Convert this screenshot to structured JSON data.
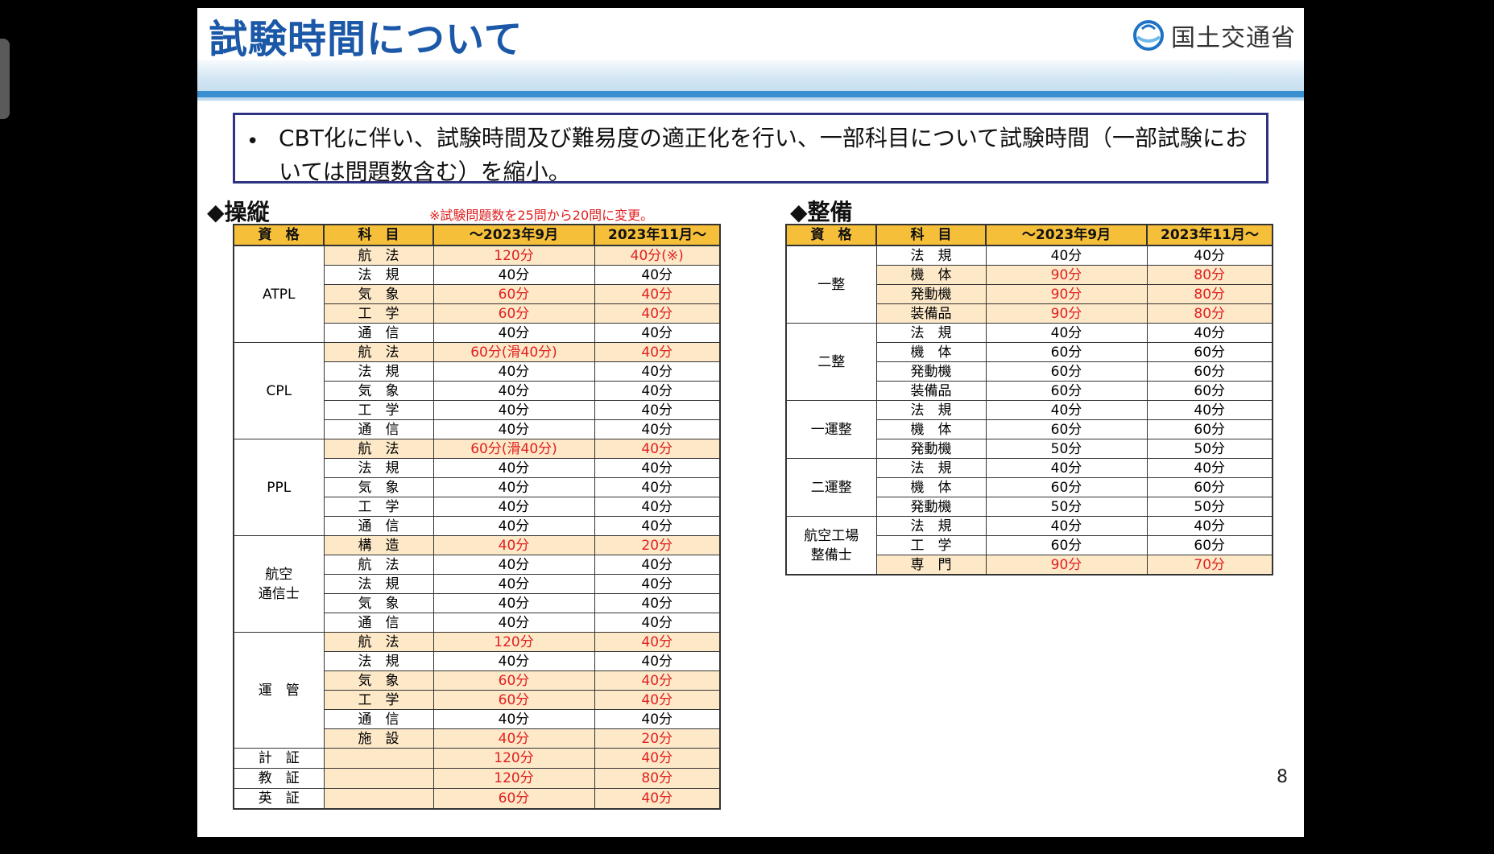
{
  "slide": {
    "title": "試験時間について",
    "logo_text": "国土交通省",
    "note": "CBT化に伴い、試験時間及び難易度の適正化を行い、一部科目について試験時間（一部試験においては問題数含む）を縮小。",
    "page_number": "8"
  },
  "pilot": {
    "section_title": "◆操縦",
    "section_note": "※試験問題数を25問から20問に変更。",
    "headers": [
      "資　格",
      "科　目",
      "～2023年9月",
      "2023年11月～"
    ],
    "rows": [
      {
        "qual": "ATPL",
        "span": 5,
        "subject": "航　法",
        "before": "120分",
        "after": "40分(※)",
        "hl": true,
        "red": true
      },
      {
        "subject": "法　規",
        "before": "40分",
        "after": "40分",
        "hl": false,
        "red": false
      },
      {
        "subject": "気　象",
        "before": "60分",
        "after": "40分",
        "hl": true,
        "red": true
      },
      {
        "subject": "工　学",
        "before": "60分",
        "after": "40分",
        "hl": true,
        "red": true
      },
      {
        "subject": "通　信",
        "before": "40分",
        "after": "40分",
        "hl": false,
        "red": false
      },
      {
        "qual": "CPL",
        "span": 5,
        "subject": "航　法",
        "before": "60分(滑40分)",
        "after": "40分",
        "hl": true,
        "red": true
      },
      {
        "subject": "法　規",
        "before": "40分",
        "after": "40分",
        "hl": false,
        "red": false
      },
      {
        "subject": "気　象",
        "before": "40分",
        "after": "40分",
        "hl": false,
        "red": false
      },
      {
        "subject": "工　学",
        "before": "40分",
        "after": "40分",
        "hl": false,
        "red": false
      },
      {
        "subject": "通　信",
        "before": "40分",
        "after": "40分",
        "hl": false,
        "red": false
      },
      {
        "qual": "PPL",
        "span": 5,
        "subject": "航　法",
        "before": "60分(滑40分)",
        "after": "40分",
        "hl": true,
        "red": true
      },
      {
        "subject": "法　規",
        "before": "40分",
        "after": "40分",
        "hl": false,
        "red": false
      },
      {
        "subject": "気　象",
        "before": "40分",
        "after": "40分",
        "hl": false,
        "red": false
      },
      {
        "subject": "工　学",
        "before": "40分",
        "after": "40分",
        "hl": false,
        "red": false
      },
      {
        "subject": "通　信",
        "before": "40分",
        "after": "40分",
        "hl": false,
        "red": false
      },
      {
        "qual": "航空\n通信士",
        "span": 5,
        "subject": "構　造",
        "before": "40分",
        "after": "20分",
        "hl": true,
        "red": true
      },
      {
        "subject": "航　法",
        "before": "40分",
        "after": "40分",
        "hl": false,
        "red": false
      },
      {
        "subject": "法　規",
        "before": "40分",
        "after": "40分",
        "hl": false,
        "red": false
      },
      {
        "subject": "気　象",
        "before": "40分",
        "after": "40分",
        "hl": false,
        "red": false
      },
      {
        "subject": "通　信",
        "before": "40分",
        "after": "40分",
        "hl": false,
        "red": false
      },
      {
        "qual": "運　管",
        "span": 6,
        "subject": "航　法",
        "before": "120分",
        "after": "40分",
        "hl": true,
        "red": true
      },
      {
        "subject": "法　規",
        "before": "40分",
        "after": "40分",
        "hl": false,
        "red": false
      },
      {
        "subject": "気　象",
        "before": "60分",
        "after": "40分",
        "hl": true,
        "red": true
      },
      {
        "subject": "工　学",
        "before": "60分",
        "after": "40分",
        "hl": true,
        "red": true
      },
      {
        "subject": "通　信",
        "before": "40分",
        "after": "40分",
        "hl": false,
        "red": false
      },
      {
        "subject": "施　設",
        "before": "40分",
        "after": "20分",
        "hl": true,
        "red": true
      },
      {
        "qual": "計　証",
        "span": 1,
        "subject": "",
        "before": "120分",
        "after": "40分",
        "hl": true,
        "red": true
      },
      {
        "qual": "教　証",
        "span": 1,
        "subject": "",
        "before": "120分",
        "after": "80分",
        "hl": true,
        "red": true
      },
      {
        "qual": "英　証",
        "span": 1,
        "subject": "",
        "before": "60分",
        "after": "40分",
        "hl": true,
        "red": true
      }
    ]
  },
  "maintenance": {
    "section_title": "◆整備",
    "headers": [
      "資　格",
      "科　目",
      "～2023年9月",
      "2023年11月～"
    ],
    "rows": [
      {
        "qual": "一整",
        "span": 4,
        "subject": "法　規",
        "before": "40分",
        "after": "40分",
        "hl": false,
        "red": false
      },
      {
        "subject": "機　体",
        "before": "90分",
        "after": "80分",
        "hl": true,
        "red": true
      },
      {
        "subject": "発動機",
        "before": "90分",
        "after": "80分",
        "hl": true,
        "red": true
      },
      {
        "subject": "装備品",
        "before": "90分",
        "after": "80分",
        "hl": true,
        "red": true
      },
      {
        "qual": "二整",
        "span": 4,
        "subject": "法　規",
        "before": "40分",
        "after": "40分",
        "hl": false,
        "red": false
      },
      {
        "subject": "機　体",
        "before": "60分",
        "after": "60分",
        "hl": false,
        "red": false
      },
      {
        "subject": "発動機",
        "before": "60分",
        "after": "60分",
        "hl": false,
        "red": false
      },
      {
        "subject": "装備品",
        "before": "60分",
        "after": "60分",
        "hl": false,
        "red": false
      },
      {
        "qual": "一運整",
        "span": 3,
        "subject": "法　規",
        "before": "40分",
        "after": "40分",
        "hl": false,
        "red": false
      },
      {
        "subject": "機　体",
        "before": "60分",
        "after": "60分",
        "hl": false,
        "red": false
      },
      {
        "subject": "発動機",
        "before": "50分",
        "after": "50分",
        "hl": false,
        "red": false
      },
      {
        "qual": "二運整",
        "span": 3,
        "subject": "法　規",
        "before": "40分",
        "after": "40分",
        "hl": false,
        "red": false
      },
      {
        "subject": "機　体",
        "before": "60分",
        "after": "60分",
        "hl": false,
        "red": false
      },
      {
        "subject": "発動機",
        "before": "50分",
        "after": "50分",
        "hl": false,
        "red": false
      },
      {
        "qual": "航空工場\n整備士",
        "span": 3,
        "subject": "法　規",
        "before": "40分",
        "after": "40分",
        "hl": false,
        "red": false
      },
      {
        "subject": "工　学",
        "before": "60分",
        "after": "60分",
        "hl": false,
        "red": false
      },
      {
        "subject": "専　門",
        "before": "90分",
        "after": "70分",
        "hl": true,
        "red": true
      }
    ]
  }
}
